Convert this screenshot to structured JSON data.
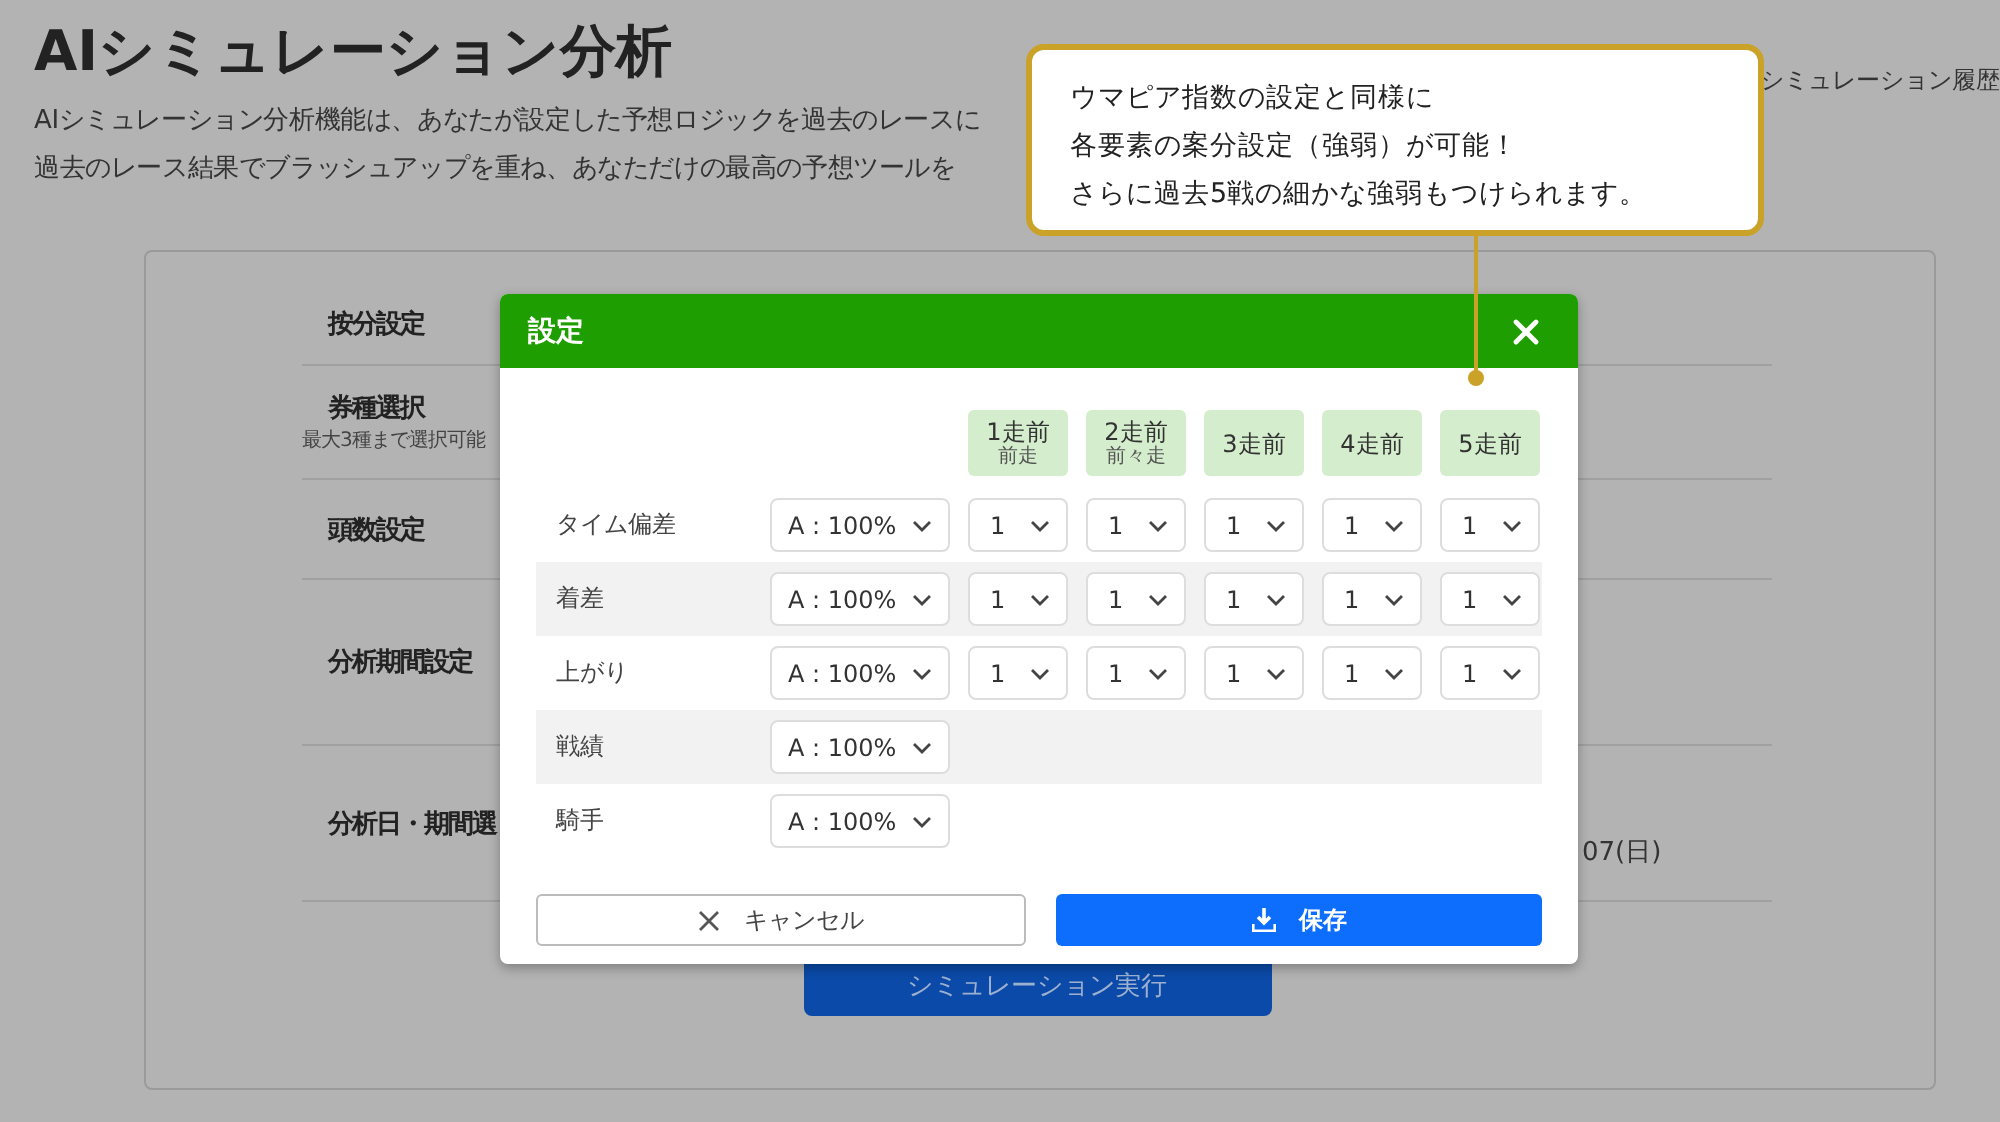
{
  "page": {
    "title": "AIシミュレーション分析",
    "description": [
      "AIシミュレーション分析機能は、あなたが設定した予想ロジックを過去のレースに",
      "過去のレース結果でブラッシュアップを重ね、あなただけの最高の予想ツールを"
    ],
    "history_link": "シミュレーション履歴"
  },
  "form": {
    "rows": [
      {
        "label": "按分設定"
      },
      {
        "label": "券種選択",
        "note": "最大3種まで選択可能"
      },
      {
        "label": "頭数設定"
      },
      {
        "label": "分析期間設定"
      },
      {
        "label": "分析日・期間選",
        "value": "07(日)"
      }
    ],
    "run_button": "シミュレーション実行"
  },
  "modal": {
    "title": "設定",
    "columns": [
      {
        "label": "1走前",
        "sub": "前走"
      },
      {
        "label": "2走前",
        "sub": "前々走"
      },
      {
        "label": "3走前"
      },
      {
        "label": "4走前"
      },
      {
        "label": "5走前"
      }
    ],
    "rows": [
      {
        "label": "タイム偏差",
        "weight": "A : 100%",
        "steps": [
          "1",
          "1",
          "1",
          "1",
          "1"
        ]
      },
      {
        "label": "着差",
        "weight": "A : 100%",
        "steps": [
          "1",
          "1",
          "1",
          "1",
          "1"
        ]
      },
      {
        "label": "上がり",
        "weight": "A : 100%",
        "steps": [
          "1",
          "1",
          "1",
          "1",
          "1"
        ]
      },
      {
        "label": "戦績",
        "weight": "A : 100%"
      },
      {
        "label": "騎手",
        "weight": "A : 100%"
      }
    ],
    "cancel": "キャンセル",
    "save": "保存"
  },
  "callout": {
    "lines": [
      "ウマピア指数の設定と同様に",
      "各要素の案分設定（強弱）が可能！",
      "さらに過去5戦の細かな強弱もつけられます。"
    ]
  }
}
